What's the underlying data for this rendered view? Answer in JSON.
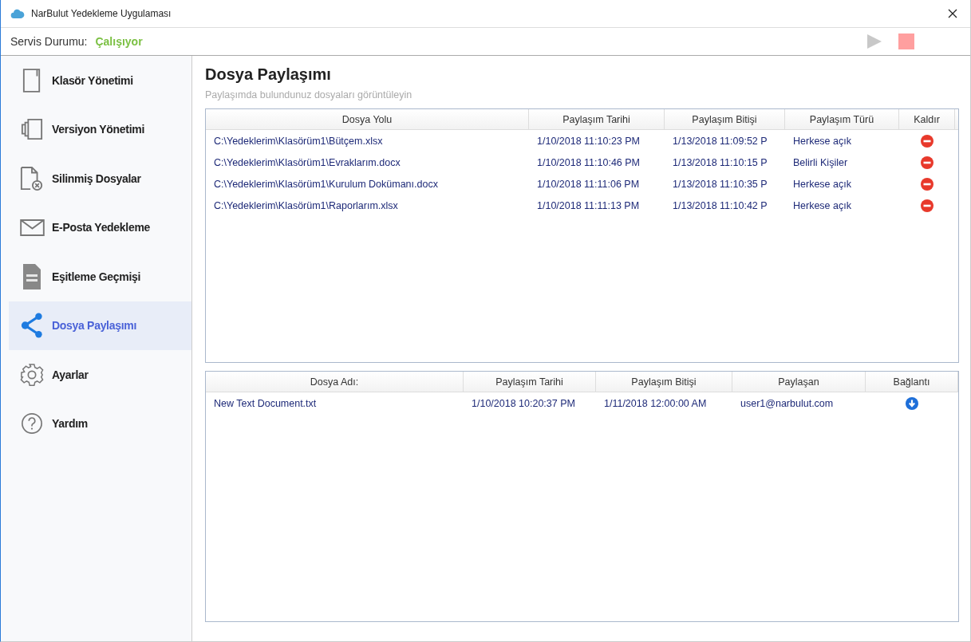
{
  "window": {
    "title": "NarBulut Yedekleme Uygulaması"
  },
  "status_bar": {
    "label": "Servis Durumu:",
    "status": "Çalışıyor",
    "controls": [
      {
        "kind": "play",
        "disabled": true
      },
      {
        "kind": "stop",
        "disabled": false
      }
    ]
  },
  "sidebar": {
    "items": [
      {
        "label": "Klasör Yönetimi",
        "kind": "folder",
        "selected": false
      },
      {
        "label": "Versiyon Yönetimi",
        "kind": "versions",
        "selected": false
      },
      {
        "label": "Silinmiş Dosyalar",
        "kind": "deleted",
        "selected": false
      },
      {
        "label": "E-Posta Yedekleme",
        "kind": "mail",
        "selected": false
      },
      {
        "label": "Eşitleme Geçmişi",
        "kind": "binary",
        "selected": false
      },
      {
        "label": "Dosya Paylaşımı",
        "kind": "share",
        "selected": true
      },
      {
        "label": "Ayarlar",
        "kind": "gear",
        "selected": false
      },
      {
        "label": "Yardım",
        "kind": "help",
        "selected": false
      }
    ]
  },
  "page": {
    "title": "Dosya Paylaşımı",
    "subtitle": "Paylaşımda bulundunuz dosyaları görüntüleyin"
  },
  "shared_table": {
    "columns": [
      "Dosya Yolu",
      "Paylaşım Tarihi",
      "Paylaşım Bitişi",
      "Paylaşım Türü",
      "Kaldır"
    ],
    "rows": [
      {
        "path": "C:\\Yedeklerim\\Klasörüm1\\Bütçem.xlsx",
        "date": "1/10/2018 11:10:23 PM",
        "end": "1/13/2018 11:09:52 P",
        "type": "Herkese açık"
      },
      {
        "path": "C:\\Yedeklerim\\Klasörüm1\\Evraklarım.docx",
        "date": "1/10/2018 11:10:46 PM",
        "end": "1/13/2018 11:10:15 P",
        "type": "Belirli Kişiler"
      },
      {
        "path": "C:\\Yedeklerim\\Klasörüm1\\Kurulum Dokümanı.docx",
        "date": "1/10/2018 11:11:06 PM",
        "end": "1/13/2018 11:10:35 P",
        "type": "Herkese açık"
      },
      {
        "path": "C:\\Yedeklerim\\Klasörüm1\\Raporlarım.xlsx",
        "date": "1/10/2018 11:11:13 PM",
        "end": "1/13/2018 11:10:42 P",
        "type": "Herkese açık"
      }
    ]
  },
  "received_table": {
    "columns": [
      "Dosya Adı:",
      "Paylaşım Tarihi",
      "Paylaşım Bitişi",
      "Paylaşan",
      "Bağlantı"
    ],
    "rows": [
      {
        "name": "New Text Document.txt",
        "date": "1/10/2018 10:20:37 PM",
        "end": "1/11/2018 12:00:00 AM",
        "sharer": "user1@narbulut.com"
      }
    ]
  }
}
